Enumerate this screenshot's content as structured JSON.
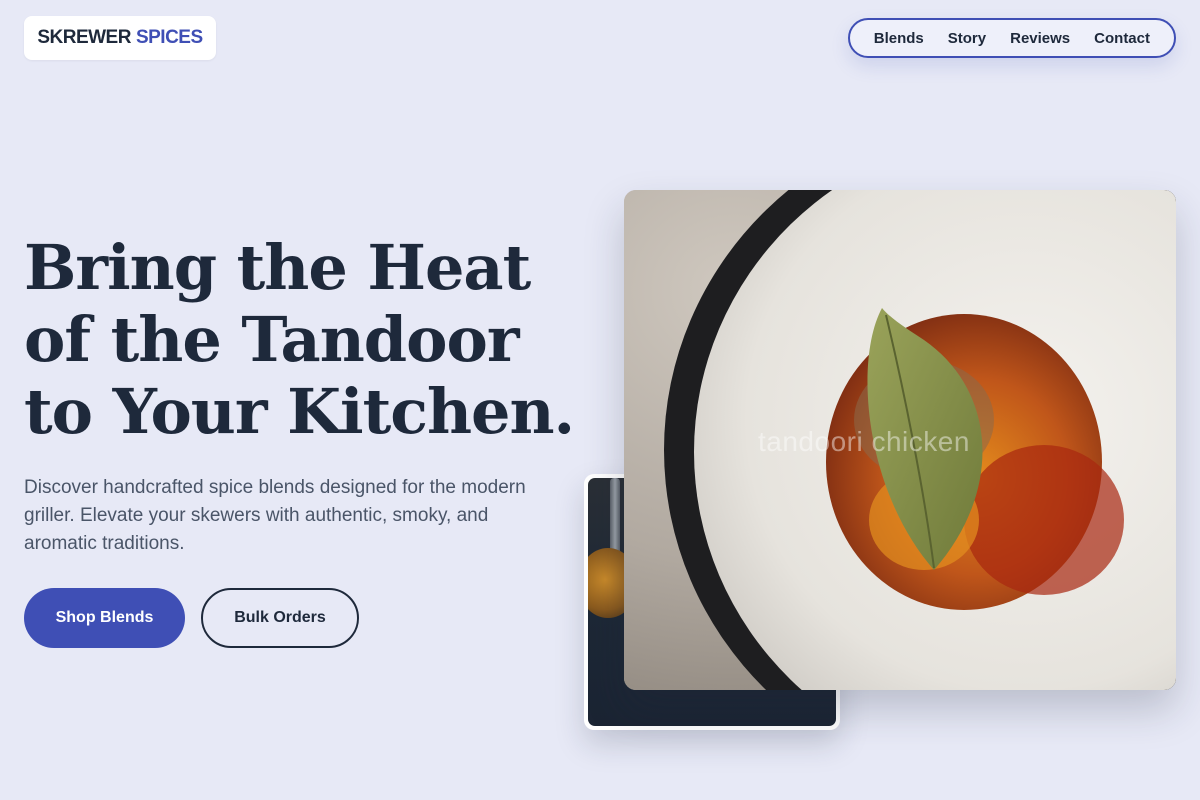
{
  "header": {
    "logo_part1": "SKREWER",
    "logo_part2": "SPICES",
    "nav": [
      "Blends",
      "Story",
      "Reviews",
      "Contact"
    ]
  },
  "hero": {
    "title_lines": [
      "Bring the Heat",
      "of the Tandoor",
      "to Your Kitchen."
    ],
    "subtitle": "Discover handcrafted spice blends designed for the modern griller. Elevate your skewers with authentic, smoky, and aromatic traditions.",
    "primary_button": "Shop Blends",
    "secondary_button": "Bulk Orders"
  },
  "images": {
    "main_watermark": "tandoori chicken"
  },
  "colors": {
    "background": "#e7e9f6",
    "accent": "#3f4fb5",
    "text_dark": "#1e293b",
    "text_muted": "#4a5568"
  }
}
